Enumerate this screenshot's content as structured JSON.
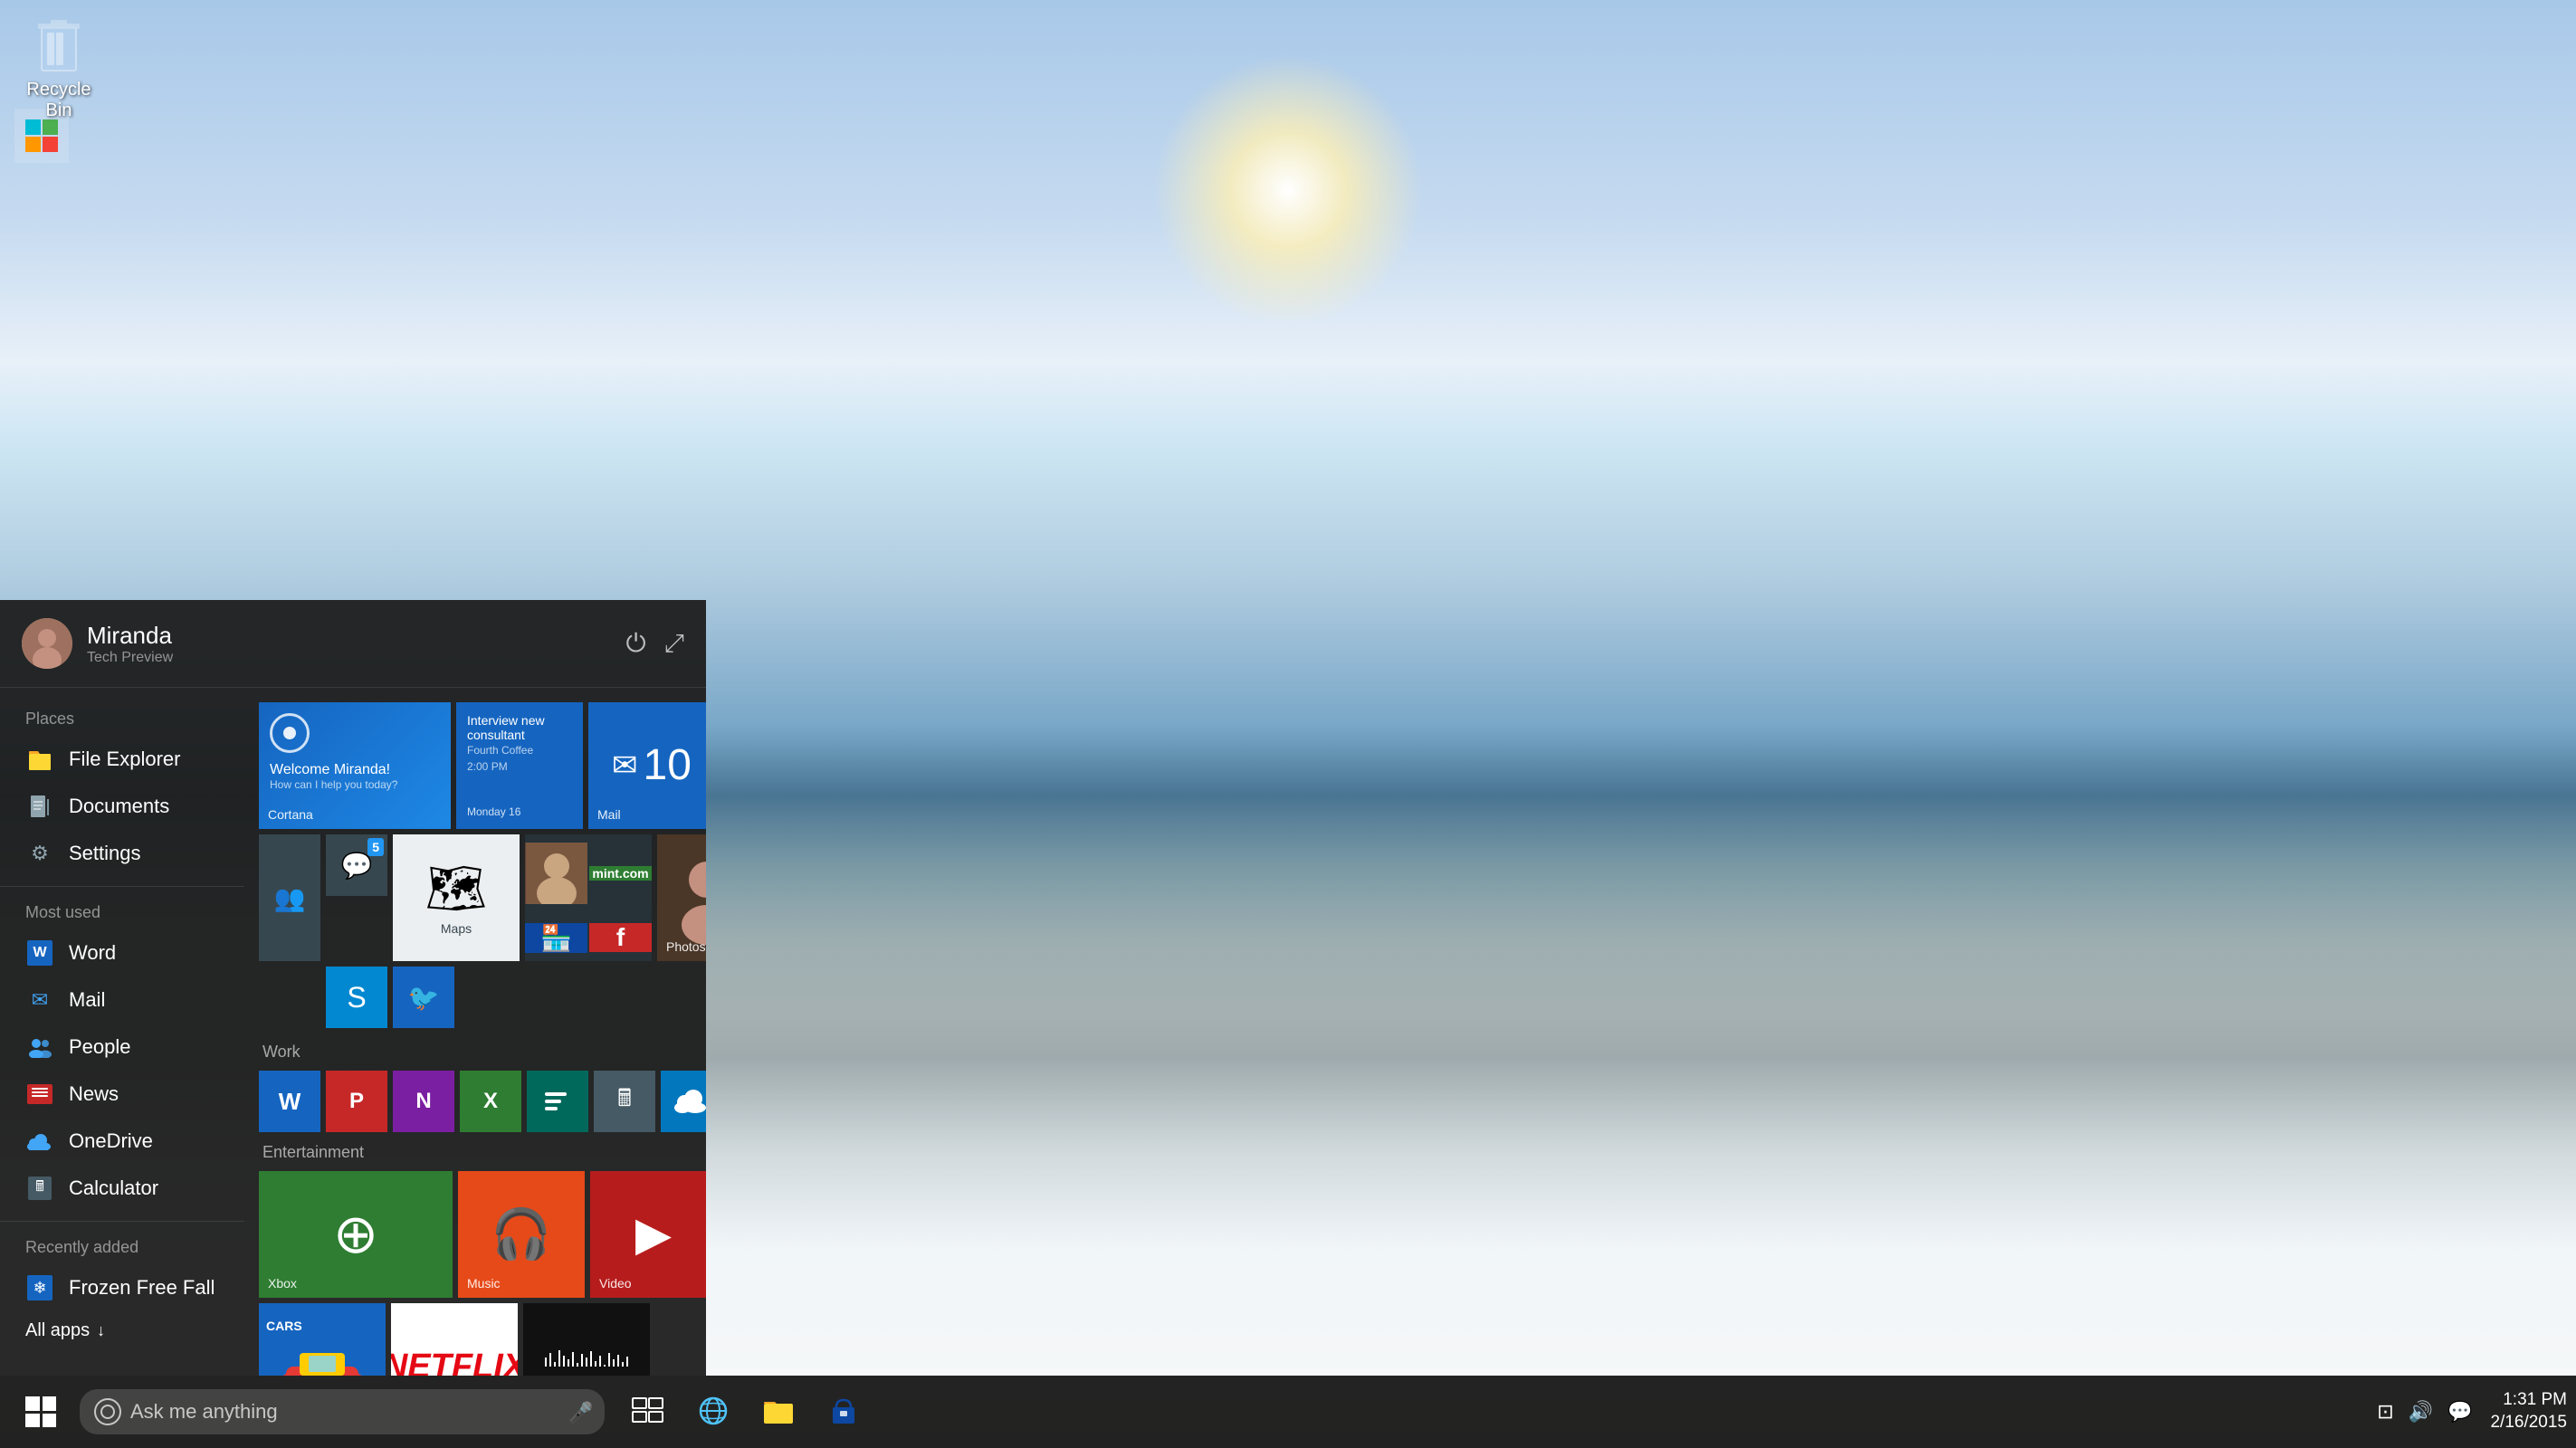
{
  "desktop": {
    "recycle_bin_label": "Recycle Bin"
  },
  "taskbar": {
    "search_placeholder": "Ask me anything",
    "time": "1:31 PM",
    "date": "2/16/2015"
  },
  "start_menu": {
    "user_name": "Miranda",
    "user_subtitle": "Tech Preview",
    "power_label": "Power",
    "expand_label": "Expand",
    "places_section": "Places",
    "places_items": [
      {
        "label": "File Explorer",
        "icon": "📁"
      },
      {
        "label": "Documents",
        "icon": "📄"
      },
      {
        "label": "Settings",
        "icon": "⚙"
      }
    ],
    "most_used_section": "Most used",
    "most_used_items": [
      {
        "label": "Word",
        "icon": "W"
      },
      {
        "label": "Mail",
        "icon": "✉"
      },
      {
        "label": "People",
        "icon": "👥"
      },
      {
        "label": "News",
        "icon": "📰"
      },
      {
        "label": "OneDrive",
        "icon": "☁"
      },
      {
        "label": "Calculator",
        "icon": "🖩"
      }
    ],
    "recently_added_section": "Recently added",
    "recently_added_items": [
      {
        "label": "Frozen Free Fall",
        "icon": "❄"
      }
    ],
    "all_apps_label": "All apps",
    "cortana": {
      "greeting": "Welcome Miranda!",
      "subtitle": "How can I help you today?",
      "label": "Cortana"
    },
    "calendar": {
      "event": "Interview new consultant",
      "sub": "Fourth Coffee",
      "time": "2:00 PM",
      "date": "Monday 16"
    },
    "mail": {
      "count": "10",
      "label": "Mail"
    },
    "maps_label": "Maps",
    "work_section": "Work",
    "work_apps": [
      "Word",
      "PowerPoint",
      "OneNote",
      "Excel",
      "Project",
      "Calculator",
      "OneDrive",
      "+"
    ],
    "entertainment_section": "Entertainment",
    "xbox_label": "Xbox",
    "music_label": "Music",
    "video_label": "Video",
    "netflix_label": "Netflix"
  }
}
